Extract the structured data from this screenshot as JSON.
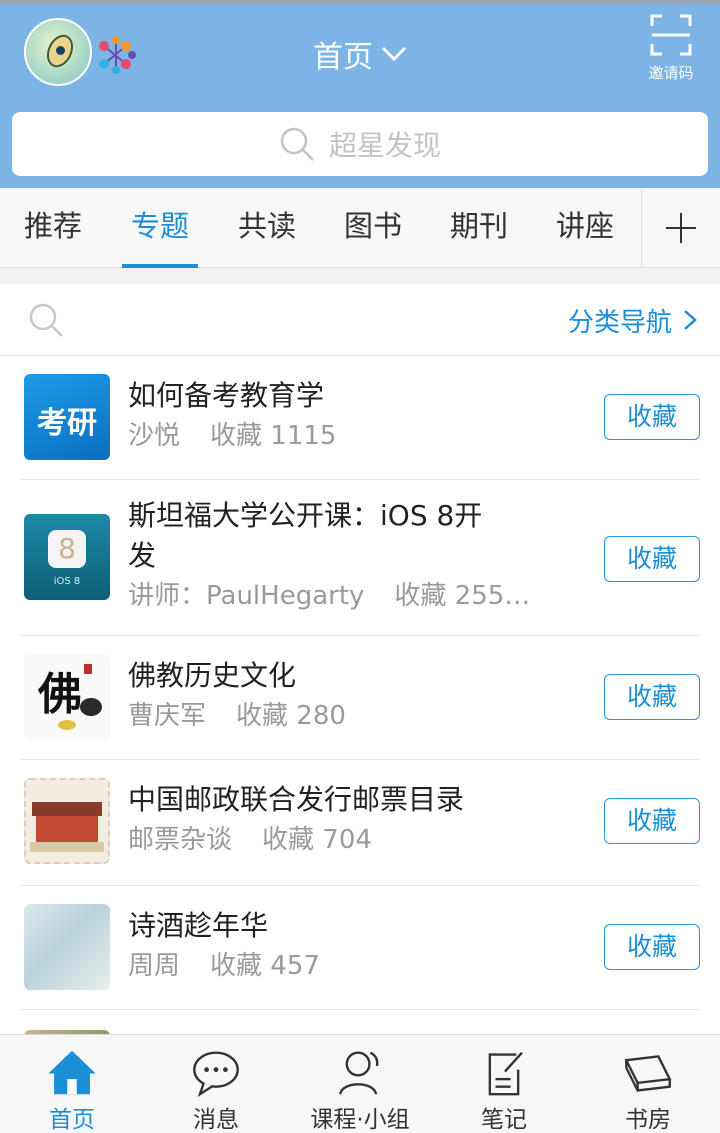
{
  "header": {
    "title": "首页",
    "invite_label": "邀请码"
  },
  "search": {
    "placeholder": "超星发现"
  },
  "tabs": [
    {
      "label": "推荐",
      "active": false
    },
    {
      "label": "专题",
      "active": true
    },
    {
      "label": "共读",
      "active": false
    },
    {
      "label": "图书",
      "active": false
    },
    {
      "label": "期刊",
      "active": false
    },
    {
      "label": "讲座",
      "active": false
    }
  ],
  "filter": {
    "category_nav_label": "分类导航"
  },
  "items": [
    {
      "title": "如何备考教育学",
      "author": "沙悦",
      "count": "收藏 1115",
      "button": "收藏",
      "thumb_text": "考研"
    },
    {
      "title": "斯坦福大学公开课：iOS 8开发",
      "author": "讲师：PaulHegarty",
      "count": "收藏 255…",
      "button": "收藏",
      "thumb_text": "iOS 8"
    },
    {
      "title": "佛教历史文化",
      "author": "曹庆军",
      "count": "收藏 280",
      "button": "收藏",
      "thumb_text": "佛"
    },
    {
      "title": "中国邮政联合发行邮票目录",
      "author": "邮票杂谈",
      "count": "收藏 704",
      "button": "收藏",
      "thumb_text": ""
    },
    {
      "title": "诗酒趁年华",
      "author": "周周",
      "count": "收藏 457",
      "button": "收藏",
      "thumb_text": ""
    }
  ],
  "bottom_nav": [
    {
      "label": "首页",
      "icon": "home-icon",
      "active": true
    },
    {
      "label": "消息",
      "icon": "chat-icon",
      "active": false
    },
    {
      "label": "课程·小组",
      "icon": "user-icon",
      "active": false
    },
    {
      "label": "笔记",
      "icon": "note-icon",
      "active": false
    },
    {
      "label": "书房",
      "icon": "bookshelf-icon",
      "active": false
    }
  ],
  "colors": {
    "header_bg": "#7cb4e6",
    "accent": "#1a8fd6",
    "text_primary": "#222222",
    "text_secondary": "#9a9a9a"
  }
}
